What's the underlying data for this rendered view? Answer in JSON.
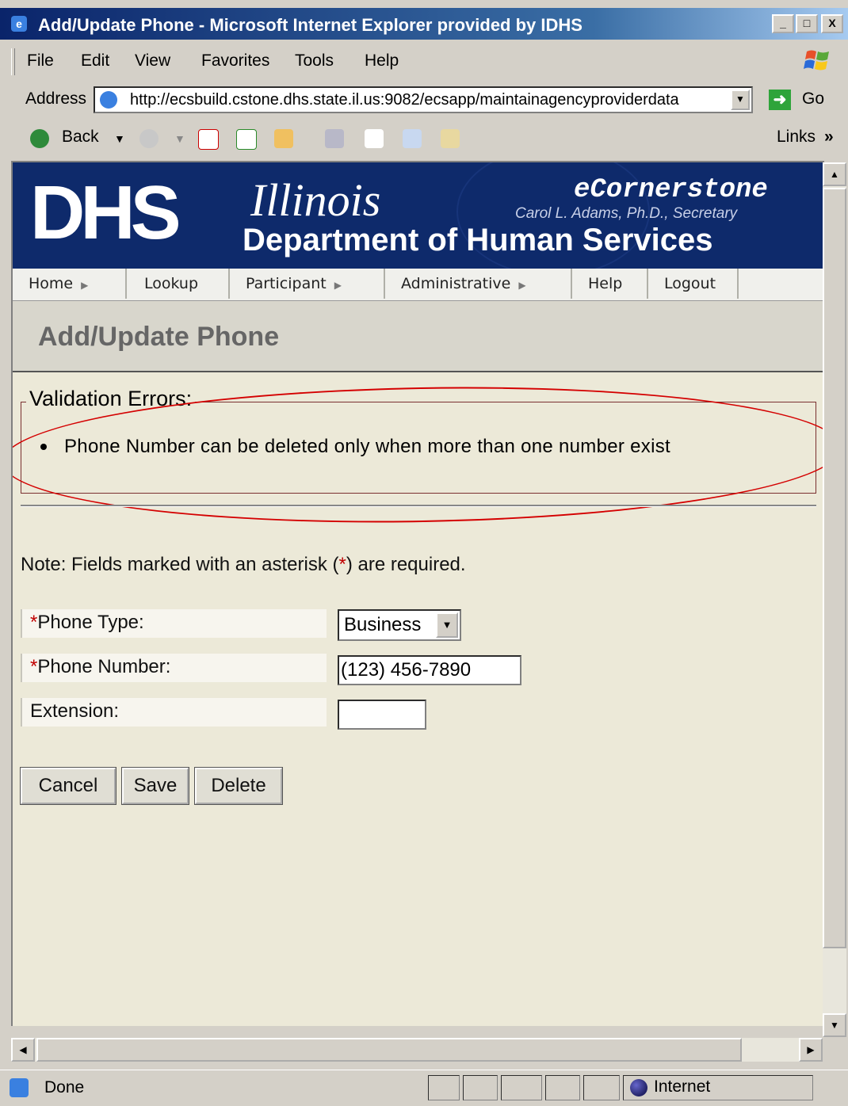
{
  "window": {
    "title": "Add/Update Phone - Microsoft Internet Explorer provided by IDHS",
    "minimize": "_",
    "maximize": "□",
    "close": "X"
  },
  "menu": {
    "items": [
      "File",
      "Edit",
      "View",
      "Favorites",
      "Tools",
      "Help"
    ]
  },
  "address": {
    "label": "Address",
    "url": "http://ecsbuild.cstone.dhs.state.il.us:9082/ecsapp/maintainagencyproviderdata",
    "go_label": "Go"
  },
  "toolbar": {
    "back_label": "Back",
    "links_label": "Links"
  },
  "banner": {
    "logo": "DHS",
    "state": "Illinois",
    "department": "Department of Human Services",
    "app_name": "eCornerstone",
    "secretary": "Carol L. Adams, Ph.D., Secretary"
  },
  "nav": {
    "items": [
      "Home",
      "Lookup",
      "Participant",
      "Administrative",
      "Help",
      "Logout"
    ]
  },
  "page": {
    "title": "Add/Update Phone"
  },
  "validation": {
    "legend": "Validation Errors:",
    "errors": [
      "Phone Number can be deleted only when more than one number exist"
    ]
  },
  "form": {
    "note_prefix": "Note: Fields marked with an asterisk (",
    "note_star": "*",
    "note_suffix": ") are required.",
    "phone_type_label": "Phone Type:",
    "phone_type_value": "Business",
    "phone_number_label": "Phone Number:",
    "phone_number_value": "(123) 456-7890",
    "extension_label": "Extension:",
    "extension_value": "",
    "required_mark": "*"
  },
  "buttons": {
    "cancel": "Cancel",
    "save": "Save",
    "delete": "Delete"
  },
  "status": {
    "text": "Done",
    "zone": "Internet"
  },
  "colors": {
    "title_bar": "#0a246a",
    "banner": "#0e2a6b",
    "required_star": "#c00000",
    "annotation_oval": "#d40000"
  }
}
